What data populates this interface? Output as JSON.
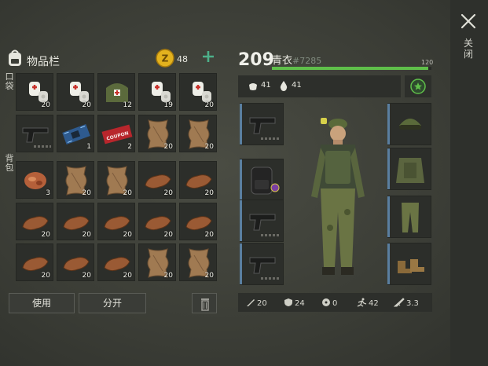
{
  "close": {
    "label": "关闭"
  },
  "inventory": {
    "title": "物品栏",
    "coins": "48",
    "pocket_label": "口袋",
    "backpack_label": "背包",
    "use_label": "使用",
    "split_label": "分开",
    "rows": [
      [
        {
          "icon": "bandage-icon",
          "qty": "20"
        },
        {
          "icon": "bandage-icon",
          "qty": "20"
        },
        {
          "icon": "medkit-bag-icon",
          "qty": "12"
        },
        {
          "icon": "bandage-icon",
          "qty": "19"
        },
        {
          "icon": "bandage-icon",
          "qty": "20"
        }
      ],
      [
        {
          "icon": "pistol-icon",
          "qty": ""
        },
        {
          "icon": "circuit-board-icon",
          "qty": "1"
        },
        {
          "icon": "coupon-ticket-icon",
          "qty": "2"
        },
        {
          "icon": "animal-hide-icon",
          "qty": "20"
        },
        {
          "icon": "animal-hide-icon",
          "qty": "20"
        }
      ],
      [
        {
          "icon": "raw-meat-icon",
          "qty": "3"
        },
        {
          "icon": "animal-hide-icon",
          "qty": "20"
        },
        {
          "icon": "animal-hide-icon",
          "qty": "20"
        },
        {
          "icon": "leather-icon",
          "qty": "20"
        },
        {
          "icon": "leather-icon",
          "qty": "20"
        }
      ],
      [
        {
          "icon": "leather-icon",
          "qty": "20"
        },
        {
          "icon": "leather-icon",
          "qty": "20"
        },
        {
          "icon": "leather-icon",
          "qty": "20"
        },
        {
          "icon": "leather-icon",
          "qty": "20"
        },
        {
          "icon": "leather-icon",
          "qty": "20"
        }
      ],
      [
        {
          "icon": "leather-icon",
          "qty": "20"
        },
        {
          "icon": "leather-icon",
          "qty": "20"
        },
        {
          "icon": "leather-icon",
          "qty": "20"
        },
        {
          "icon": "animal-hide-icon",
          "qty": "20"
        },
        {
          "icon": "animal-hide-icon",
          "qty": "20"
        }
      ]
    ],
    "coupon_text": "COUPON"
  },
  "character": {
    "level": "209",
    "name": "青衣",
    "id": "#7285",
    "xp_max": "120",
    "xp_fraction": 0.98,
    "food": "41",
    "water": "41",
    "stats": {
      "attack": "20",
      "defense": "24",
      "radiation": "0",
      "speed": "42",
      "weapon": "3.3"
    },
    "equipment_left": [
      "pistol-icon",
      "backpack-icon",
      "pistol-icon",
      "pistol-icon"
    ],
    "equipment_right": [
      "cap-goggles-icon",
      "military-vest-icon",
      "camo-pants-icon",
      "boots-icon"
    ]
  },
  "colors": {
    "accent_green": "#5fbf4a",
    "slot_edge": "#5a7fa0",
    "coin_gold": "#e3b21e"
  }
}
